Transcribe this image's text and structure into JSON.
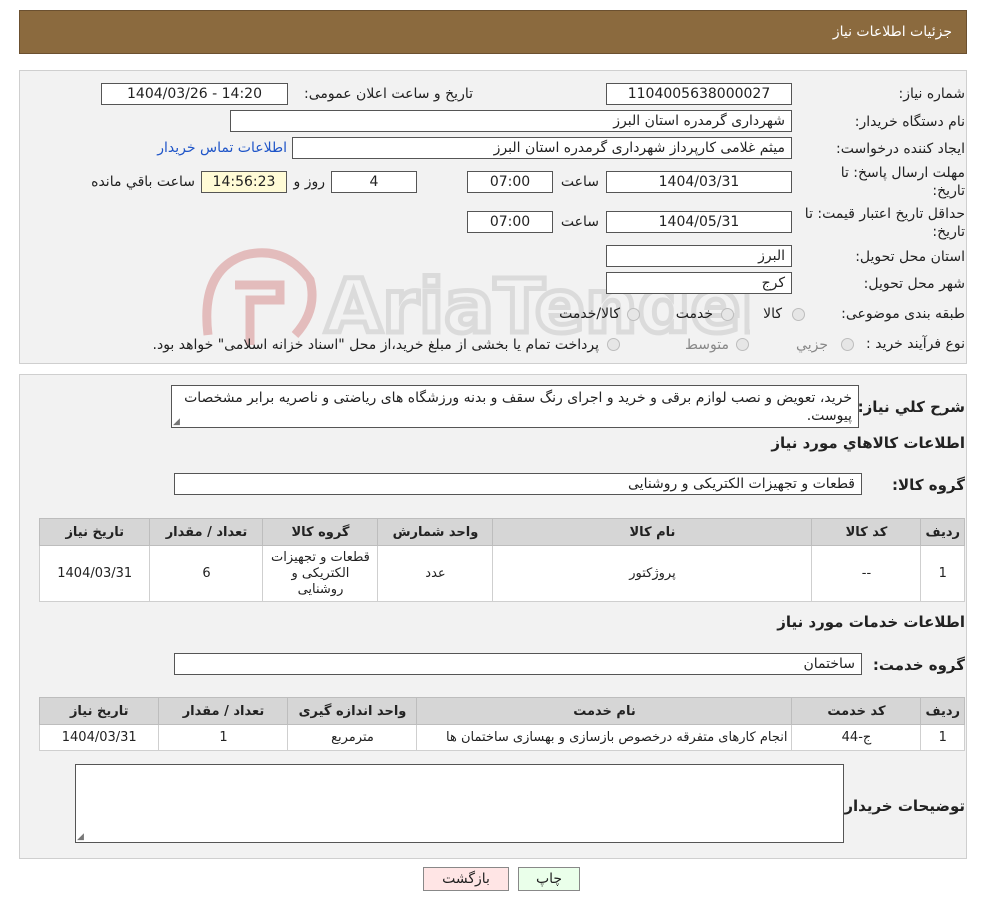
{
  "header": {
    "title": "جزئیات اطلاعات نیاز"
  },
  "watermark_text": "AriaTender.neT",
  "fields": {
    "need_number_label": "شماره نیاز:",
    "need_number": "1104005638000027",
    "announce_label": "تاریخ و ساعت اعلان عمومی:",
    "announce_value": "1404/03/26 - 14:20",
    "buyer_org_label": "نام دستگاه خریدار:",
    "buyer_org": "شهرداری گرمدره استان البرز",
    "requester_label": "ایجاد کننده درخواست:",
    "requester": "میثم غلامی کارپرداز شهرداری گرمدره استان البرز",
    "contact_link": "اطلاعات تماس خریدار",
    "deadline_label_1": "مهلت ارسال پاسخ: تا",
    "deadline_label_2": "تاریخ:",
    "deadline_date": "1404/03/31",
    "time_label": "ساعت",
    "deadline_time": "07:00",
    "days_value": "4",
    "days_label": "روز و",
    "remaining_time": "14:56:23",
    "remaining_label": "ساعت باقي مانده",
    "validity_label_1": "حداقل تاریخ اعتبار قیمت: تا",
    "validity_label_2": "تاریخ:",
    "validity_date": "1404/05/31",
    "validity_time": "07:00",
    "province_label": "استان محل تحویل:",
    "province": "البرز",
    "city_label": "شهر محل تحویل:",
    "city": "کرج",
    "category_label": "طبقه بندی موضوعی:",
    "category_options": [
      "کالا",
      "خدمت",
      "کالا/خدمت"
    ],
    "process_label": "نوع فرآیند خرید :",
    "process_options": [
      "جزیي",
      "متوسط"
    ],
    "process_note": "پرداخت تمام یا بخشی از مبلغ خرید،از محل \"اسناد خزانه اسلامی\" خواهد بود."
  },
  "description": {
    "label": "شرح کلي نیاز:",
    "text": "خرید، تعویض و نصب لوازم برقی و خرید و اجرای رنگ سقف و بدنه ورزشگاه های ریاضتی و ناصریه برابر مشخصات پیوست."
  },
  "goods": {
    "section_title": "اطلاعات کالاهاي مورد نیاز",
    "group_label": "گروه کالا:",
    "group_value": "قطعات و تجهیزات الکتریکی و روشنایی",
    "headers": [
      "ردیف",
      "کد کالا",
      "نام کالا",
      "واحد شمارش",
      "گروه کالا",
      "تعداد / مقدار",
      "تاریخ نیاز"
    ],
    "rows": [
      [
        "1",
        "--",
        "پروژکتور",
        "عدد",
        "قطعات و تجهیزات الکتریکی و روشنایی",
        "6",
        "1404/03/31"
      ]
    ]
  },
  "services": {
    "section_title": "اطلاعات خدمات مورد نیاز",
    "group_label": "گروه خدمت:",
    "group_value": "ساختمان",
    "headers": [
      "ردیف",
      "کد خدمت",
      "نام خدمت",
      "واحد اندازه گیری",
      "تعداد / مقدار",
      "تاریخ نیاز"
    ],
    "rows": [
      [
        "1",
        "ج-44",
        "انجام کارهای متفرقه درخصوص بازسازی و بهسازی ساختمان ها",
        "مترمربع",
        "1",
        "1404/03/31"
      ]
    ]
  },
  "buyer_notes": {
    "label": "توضیحات خریدار:",
    "value": ""
  },
  "buttons": {
    "print": "چاپ",
    "back": "بازگشت"
  },
  "colors": {
    "header_bg": "#8b6a3e",
    "print_bg": "#eaffea",
    "back_bg": "#ffe5e5",
    "link": "#1f55c8"
  }
}
